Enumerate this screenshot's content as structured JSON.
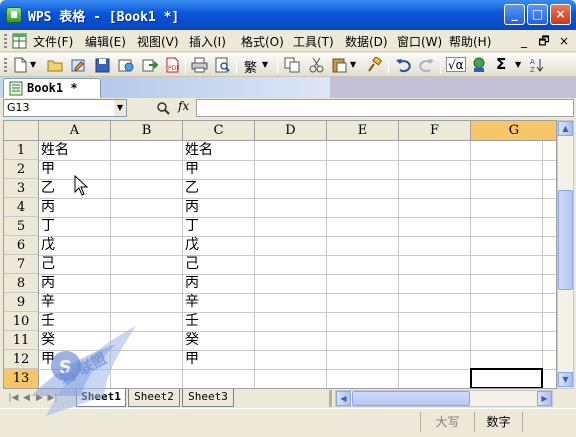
{
  "window": {
    "title": "WPS 表格 - [Book1 *]",
    "buttons": {
      "minimize": "_",
      "maximize": "□",
      "close": "×"
    }
  },
  "menubar": {
    "items": [
      "文件(F)",
      "编辑(E)",
      "视图(V)",
      "插入(I)",
      "格式(O)",
      "工具(T)",
      "数据(D)",
      "窗口(W)",
      "帮助(H)"
    ],
    "mdi_controls": [
      "_",
      "🗗",
      "×"
    ]
  },
  "toolbar": {
    "icons": [
      "new-icon",
      "open-icon",
      "edit-icon",
      "save-icon",
      "publish-icon",
      "export-icon",
      "pdf-icon",
      "print-icon",
      "print-preview-icon",
      "traditional-chinese-icon",
      "copy-icon",
      "cut-icon",
      "paste-icon",
      "format-painter-icon",
      "undo-icon",
      "redo-icon",
      "function-icon",
      "chart-icon",
      "sum-icon",
      "sort-icon"
    ],
    "traditional_label": "繁",
    "function_label": "√α",
    "sum_label": "Σ"
  },
  "document_tab": {
    "label": "Book1 *"
  },
  "formula_bar": {
    "name_box": "G13",
    "fx_label": "fx",
    "formula_value": ""
  },
  "sheet": {
    "columns": [
      "A",
      "B",
      "C",
      "D",
      "E",
      "F",
      "G"
    ],
    "rows": [
      "1",
      "2",
      "3",
      "4",
      "5",
      "6",
      "7",
      "8",
      "9",
      "10",
      "11",
      "12",
      "13"
    ],
    "column_A": [
      "姓名",
      "甲",
      "乙",
      "丙",
      "丁",
      "戊",
      "己",
      "丙",
      "辛",
      "壬",
      "癸",
      "甲",
      ""
    ],
    "column_C": [
      "姓名",
      "甲",
      "乙",
      "丙",
      "丁",
      "戊",
      "己",
      "丙",
      "辛",
      "壬",
      "癸",
      "甲",
      ""
    ],
    "selected_cell": "G13"
  },
  "sheet_tabs": [
    "Sheet1",
    "Sheet2",
    "Sheet3"
  ],
  "statusbar": {
    "caps": "大写",
    "num": "数字"
  },
  "watermark": {
    "text": "岩 联盟"
  },
  "colors": {
    "title_blue": "#0a55d8",
    "selection_orange": "#f7c56a",
    "tab_blue": "#c7d8f1"
  }
}
